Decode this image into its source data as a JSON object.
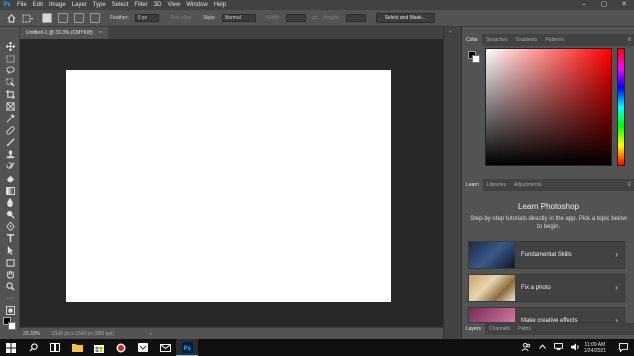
{
  "menubar": {
    "logo": "Ps",
    "items": [
      "File",
      "Edit",
      "Image",
      "Layer",
      "Type",
      "Select",
      "Filter",
      "3D",
      "View",
      "Window",
      "Help"
    ],
    "window_controls": [
      "–",
      "▢",
      "✕"
    ]
  },
  "options": {
    "feather_label": "Feather:",
    "feather_value": "0 px",
    "antialias_label": "Anti-alias",
    "style_label": "Style:",
    "style_value": "Normal",
    "width_label": "Width:",
    "height_label": "Height:",
    "select_mask_label": "Select and Mask..."
  },
  "document": {
    "tab_label": "Untitled-1 @ 33.3% (CMYK/8)",
    "tab_close": "×"
  },
  "status": {
    "zoom": "33.33%",
    "doc_size": "2100 px x 1500 px (300 ppi)",
    "arrow": "›"
  },
  "color_panel": {
    "tabs": [
      "Color",
      "Swatches",
      "Gradients",
      "Patterns"
    ],
    "menu": "≡"
  },
  "learn_panel": {
    "tabs": [
      "Learn",
      "Libraries",
      "Adjustments"
    ],
    "menu": "≡",
    "title": "Learn Photoshop",
    "description": "Step-by-step tutorials directly in the app. Pick a topic below to begin.",
    "cards": [
      {
        "title": "Fundamental Skills",
        "chevron": "›"
      },
      {
        "title": "Fix a photo",
        "chevron": "›"
      },
      {
        "title": "Make creative effects",
        "chevron": "›"
      }
    ]
  },
  "layers_panel": {
    "tabs": [
      "Layers",
      "Channels",
      "Paths"
    ]
  },
  "taskbar": {
    "time": "11:09 AM",
    "date": "1/24/2021"
  },
  "colors": {
    "accent": "#31a8ff",
    "canvas_bg": "#282828",
    "panel_bg": "#535353"
  }
}
